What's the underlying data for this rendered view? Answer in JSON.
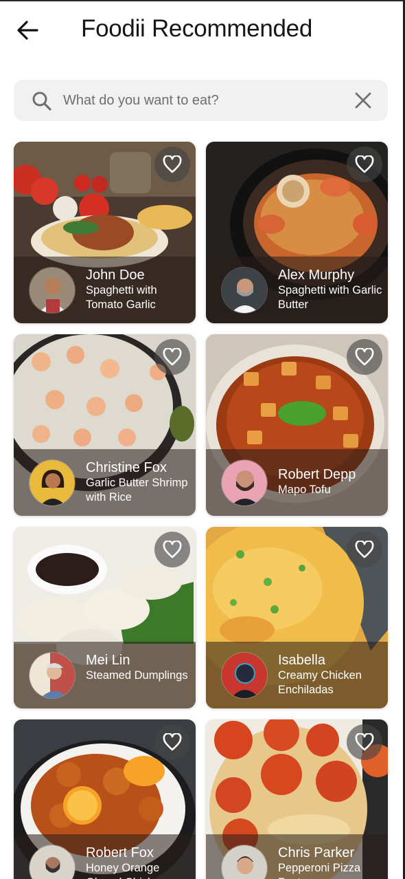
{
  "header": {
    "title": "Foodii Recommended"
  },
  "search": {
    "placeholder": "What do you want to eat?",
    "value": ""
  },
  "cards": [
    {
      "chef": "John Doe",
      "dish": "Spaghetti with Tomato Garlic"
    },
    {
      "chef": "Alex Murphy",
      "dish": "Spaghetti with Garlic Butter"
    },
    {
      "chef": "Christine Fox",
      "dish": "Garlic Butter Shrimp with Rice"
    },
    {
      "chef": "Robert Depp",
      "dish": "Mapo Tofu"
    },
    {
      "chef": "Mei Lin",
      "dish": "Steamed Dumplings"
    },
    {
      "chef": "Isabella",
      "dish": "Creamy Chicken Enchiladas"
    },
    {
      "chef": "Robert Fox",
      "dish": "Honey Orange Glazed Chicken"
    },
    {
      "chef": "Chris Parker",
      "dish": "Pepperoni Pizza Pasta"
    }
  ],
  "icons": {
    "back": "arrow-left-icon",
    "search": "search-icon",
    "clear": "close-icon",
    "favorite": "heart-outline-icon"
  },
  "colors": {
    "title": "#161616",
    "search_bg": "#f1f1f1",
    "overlay": "#281e19"
  }
}
